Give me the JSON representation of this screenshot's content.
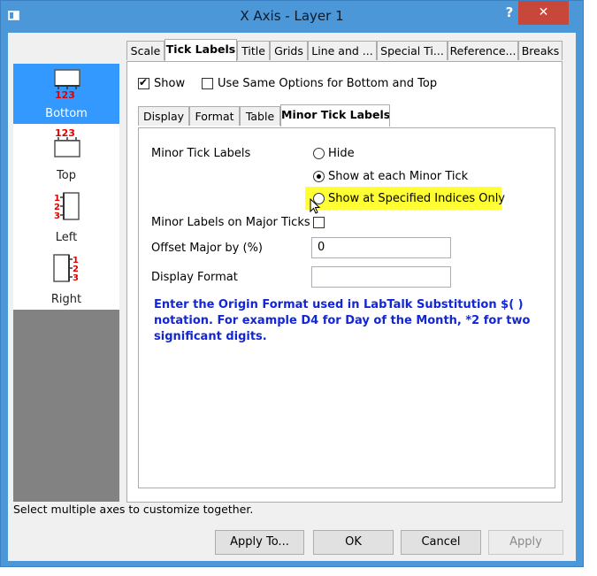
{
  "window": {
    "title": "X Axis - Layer 1",
    "help_label": "?",
    "close_label": "✕"
  },
  "sidebar": {
    "items": [
      {
        "label": "Bottom",
        "selected": true,
        "icon": "axis-bottom-icon"
      },
      {
        "label": "Top",
        "selected": false,
        "icon": "axis-top-icon"
      },
      {
        "label": "Left",
        "selected": false,
        "icon": "axis-left-icon"
      },
      {
        "label": "Right",
        "selected": false,
        "icon": "axis-right-icon"
      }
    ]
  },
  "top_tabs": [
    {
      "label": "Scale"
    },
    {
      "label": "Tick Labels",
      "active": true
    },
    {
      "label": "Title"
    },
    {
      "label": "Grids"
    },
    {
      "label": "Line and ..."
    },
    {
      "label": "Special Ti..."
    },
    {
      "label": "Reference..."
    },
    {
      "label": "Breaks"
    }
  ],
  "show": {
    "label": "Show",
    "checked": true
  },
  "same_options": {
    "label": "Use Same Options for Bottom and Top",
    "checked": false
  },
  "sub_tabs": [
    {
      "label": "Display"
    },
    {
      "label": "Format"
    },
    {
      "label": "Table"
    },
    {
      "label": "Minor Tick Labels",
      "active": true
    }
  ],
  "minor": {
    "section_label": "Minor Tick Labels",
    "options": [
      {
        "label": "Hide",
        "checked": false
      },
      {
        "label": "Show at each Minor Tick",
        "checked": true
      },
      {
        "label": "Show at Specified Indices Only",
        "checked": false,
        "highlighted": true
      }
    ],
    "labels_on_major": {
      "label": "Minor Labels on Major Ticks",
      "checked": false
    },
    "offset": {
      "label": "Offset Major by (%)",
      "value": "0"
    },
    "display_format": {
      "label": "Display Format",
      "value": ""
    },
    "note": "Enter the Origin Format used in LabTalk Substitution $( ) notation. For example D4 for Day of the Month, *2 for two significant digits."
  },
  "status": "Select multiple axes to customize together.",
  "buttons": {
    "apply_to": "Apply To...",
    "ok": "OK",
    "cancel": "Cancel",
    "apply": "Apply"
  },
  "colors": {
    "titlebar": "#4b97d8",
    "selected": "#3399ff",
    "highlight": "#ffff33",
    "note": "#1226d6",
    "close": "#c7483b"
  }
}
